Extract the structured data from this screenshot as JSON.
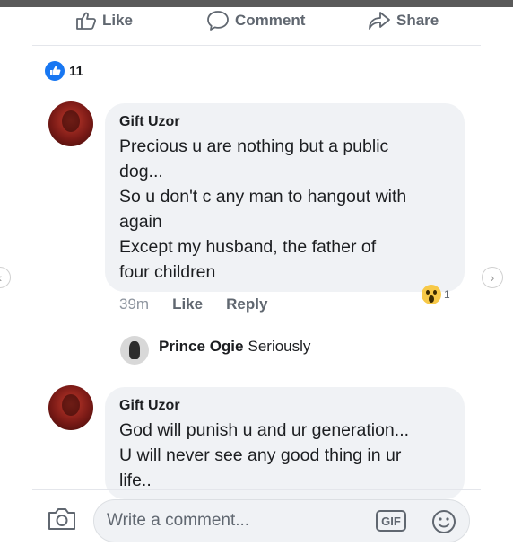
{
  "actions": {
    "like_label": "Like",
    "comment_label": "Comment",
    "share_label": "Share"
  },
  "reactions": {
    "count": "11"
  },
  "comments": [
    {
      "author": "Gift Uzor",
      "lines": [
        "Precious u are nothing but a public",
        "dog...",
        "So u don't c any man to hangout with",
        "again",
        "Except my husband, the father of",
        "four children"
      ],
      "time": "39m",
      "like_label": "Like",
      "reply_label": "Reply",
      "reaction_count": "1"
    },
    {
      "author": "Gift Uzor",
      "lines": [
        "God will punish u and ur generation...",
        "U will never see any good thing in ur",
        "life.."
      ]
    }
  ],
  "reply": {
    "author": "Prince Ogie",
    "text": "Seriously"
  },
  "composer": {
    "placeholder": "Write a comment...",
    "gif_label": "GIF"
  },
  "colors": {
    "brand_blue": "#1877f2",
    "bubble": "#f0f2f5",
    "muted": "#606770"
  },
  "icons": {
    "like": "thumbs-up-icon",
    "comment": "speech-bubble-icon",
    "share": "share-arrow-icon",
    "camera": "camera-icon",
    "emoji": "smiley-icon",
    "wow": "wow-reaction-icon"
  }
}
